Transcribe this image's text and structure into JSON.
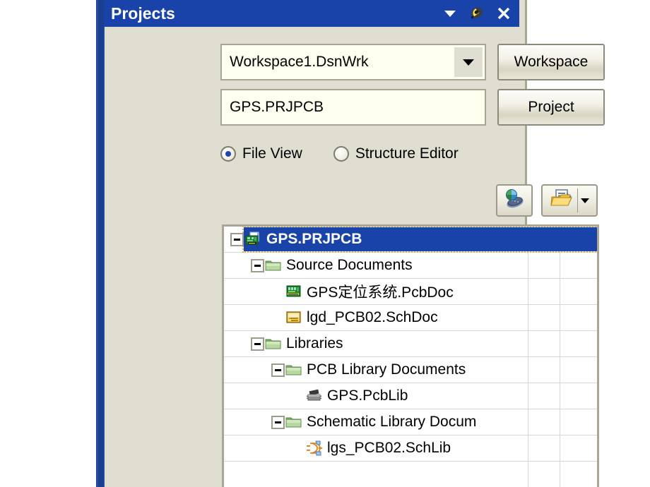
{
  "panel": {
    "title": "Projects",
    "title_icons": [
      {
        "name": "dropdown-menu-icon",
        "glyph": "▼"
      },
      {
        "name": "pin-icon",
        "glyph": "pin"
      },
      {
        "name": "close-icon",
        "glyph": "✕"
      }
    ],
    "colors": {
      "titlebar": "#1943a8",
      "panel_bg": "#e0ded0",
      "field_bg": "#fffff0",
      "selection": "#1943a8",
      "focus_border": "#d4b55a"
    }
  },
  "workspace_row": {
    "combo_value": "Workspace1.DsnWrk",
    "combo_placeholder": "Workspace1.DsnWrk",
    "button_label": "Workspace"
  },
  "project_row": {
    "text_value": "GPS.PRJPCB",
    "text_placeholder": "GPS.PRJPCB",
    "button_label": "Project"
  },
  "view_mode": {
    "options": [
      {
        "label": "File View",
        "selected": true
      },
      {
        "label": "Structure Editor",
        "selected": false
      }
    ]
  },
  "toolbar": {
    "buttons": [
      {
        "name": "navigate-button",
        "icon": "globe-pcb-icon",
        "has_dropdown": false
      },
      {
        "name": "open-document-button",
        "icon": "open-folder-document-icon",
        "has_dropdown": true
      }
    ]
  },
  "tree": {
    "columns": 2,
    "nodes": [
      {
        "label": "GPS.PRJPCB",
        "indent": 0,
        "expander": "minus",
        "icon": "pcb-project-icon",
        "selected": true
      },
      {
        "label": "Source Documents",
        "indent": 1,
        "expander": "minus",
        "icon": "folder-green-icon",
        "selected": false
      },
      {
        "label": "GPS定位系统.PcbDoc",
        "indent": 2,
        "expander": "none",
        "icon": "pcb-document-icon",
        "selected": false
      },
      {
        "label": "lgd_PCB02.SchDoc",
        "indent": 2,
        "expander": "none",
        "icon": "schematic-doc-icon",
        "selected": false
      },
      {
        "label": "Libraries",
        "indent": 1,
        "expander": "minus",
        "icon": "folder-green-icon",
        "selected": false
      },
      {
        "label": "PCB Library Documents",
        "indent": 2,
        "expander": "minus",
        "icon": "folder-green-icon",
        "selected": false
      },
      {
        "label": "GPS.PcbLib",
        "indent": 3,
        "expander": "none",
        "icon": "ic-chip-icon",
        "selected": false
      },
      {
        "label": "Schematic Library Docum",
        "indent": 2,
        "expander": "minus",
        "icon": "folder-green-icon",
        "selected": false
      },
      {
        "label": "lgs_PCB02.SchLib",
        "indent": 3,
        "expander": "none",
        "icon": "logic-gate-icon",
        "selected": false
      }
    ]
  }
}
